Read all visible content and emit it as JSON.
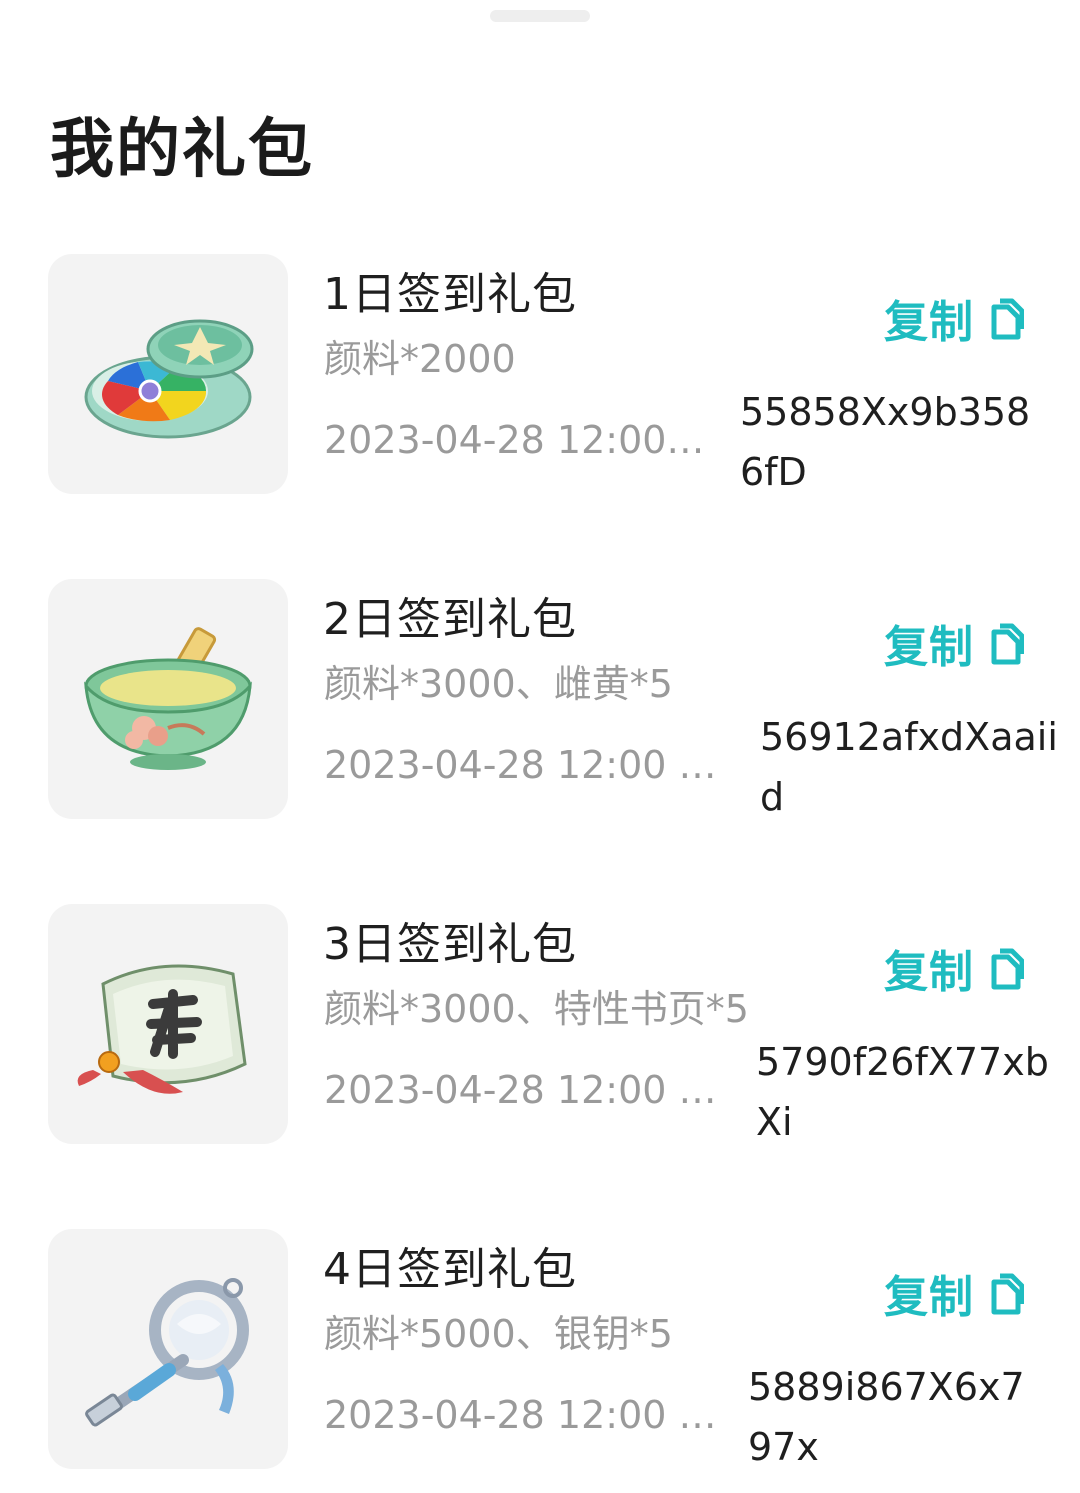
{
  "page_title": "我的礼包",
  "gifts": [
    {
      "name": "1日签到礼包",
      "desc": "颜料*2000",
      "time": "2023-04-28 12:00…",
      "copy_label": "复制",
      "code": "55858Xx9b3586fD"
    },
    {
      "name": "2日签到礼包",
      "desc": "颜料*3000、雌黄*5",
      "time": "2023-04-28 12:00 …",
      "copy_label": "复制",
      "code": "56912afxdXaaiid"
    },
    {
      "name": "3日签到礼包",
      "desc": "颜料*3000、特性书页*5",
      "time": "2023-04-28 12:00 …",
      "copy_label": "复制",
      "code": "5790f26fX77xbXi"
    },
    {
      "name": "4日签到礼包",
      "desc": "颜料*5000、银钥*5",
      "time": "2023-04-28 12:00 …",
      "copy_label": "复制",
      "code": "5889i867X6x797x"
    }
  ],
  "accent_color": "#1fbcc0"
}
